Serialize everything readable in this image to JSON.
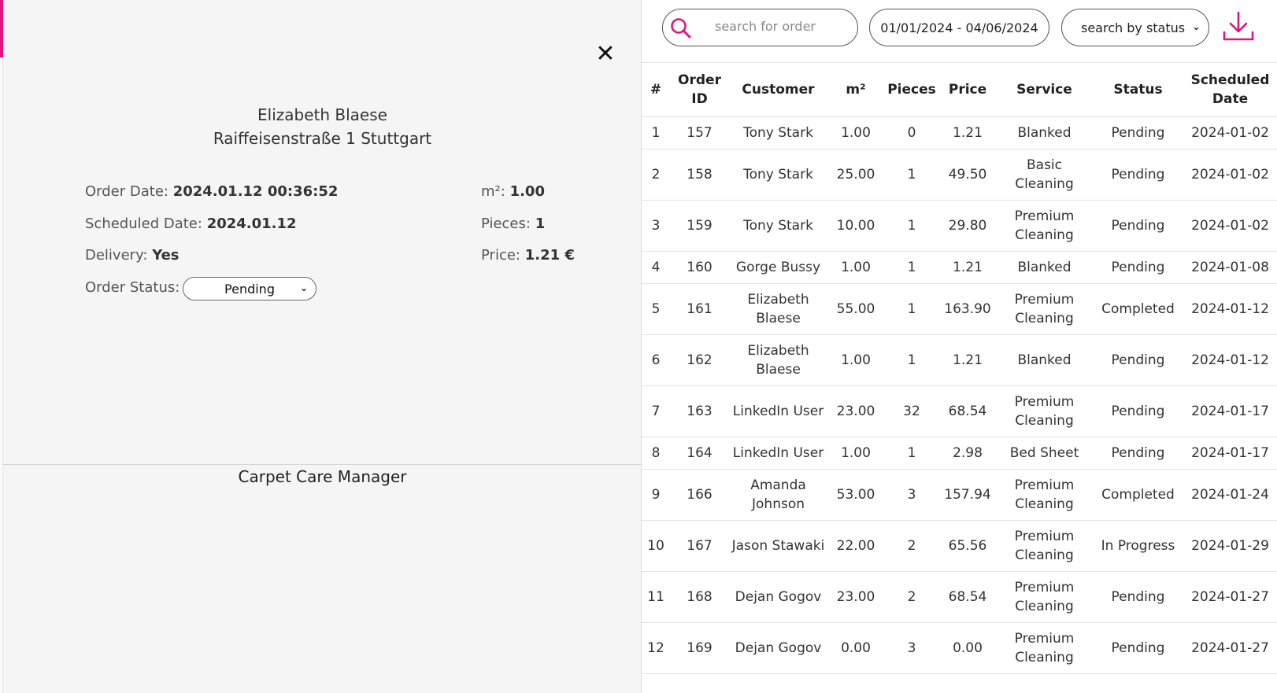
{
  "detail": {
    "close_symbol": "✕",
    "customer_name": "Elizabeth Blaese",
    "address": "Raiffeisenstraße 1 Stuttgart",
    "order_date_label": "Order Date:",
    "order_date_value": "2024.01.12 00:36:52",
    "scheduled_date_label": "Scheduled Date:",
    "scheduled_date_value": "2024.01.12",
    "delivery_label": "Delivery:",
    "delivery_value": "Yes",
    "order_status_label": "Order Status:",
    "order_status_value": "Pending",
    "area_label": "m²:",
    "area_value": "1.00",
    "pieces_label": "Pieces:",
    "pieces_value": "1",
    "price_label": "Price:",
    "price_value": "1.21 €"
  },
  "app": {
    "title": "Carpet Care Manager"
  },
  "toolbar": {
    "search_placeholder": "search for order",
    "date_range": "01/01/2024 - 04/06/2024",
    "status_filter": "search by status"
  },
  "colors": {
    "accent": "#e0147a"
  },
  "icons": {
    "search": "search-icon",
    "download": "download-icon",
    "close": "close-icon",
    "chevron": "chevron-down-icon"
  },
  "table": {
    "headers": [
      "#",
      "Order ID",
      "Customer",
      "m²",
      "Pieces",
      "Price",
      "Service",
      "Status",
      "Scheduled Date"
    ],
    "rows": [
      [
        "1",
        "157",
        "Tony Stark",
        "1.00",
        "0",
        "1.21",
        "Blanked",
        "Pending",
        "2024-01-02"
      ],
      [
        "2",
        "158",
        "Tony Stark",
        "25.00",
        "1",
        "49.50",
        "Basic Cleaning",
        "Pending",
        "2024-01-02"
      ],
      [
        "3",
        "159",
        "Tony Stark",
        "10.00",
        "1",
        "29.80",
        "Premium Cleaning",
        "Pending",
        "2024-01-02"
      ],
      [
        "4",
        "160",
        "Gorge Bussy",
        "1.00",
        "1",
        "1.21",
        "Blanked",
        "Pending",
        "2024-01-08"
      ],
      [
        "5",
        "161",
        "Elizabeth Blaese",
        "55.00",
        "1",
        "163.90",
        "Premium Cleaning",
        "Completed",
        "2024-01-12"
      ],
      [
        "6",
        "162",
        "Elizabeth Blaese",
        "1.00",
        "1",
        "1.21",
        "Blanked",
        "Pending",
        "2024-01-12"
      ],
      [
        "7",
        "163",
        "LinkedIn User",
        "23.00",
        "32",
        "68.54",
        "Premium Cleaning",
        "Pending",
        "2024-01-17"
      ],
      [
        "8",
        "164",
        "LinkedIn User",
        "1.00",
        "1",
        "2.98",
        "Bed Sheet",
        "Pending",
        "2024-01-17"
      ],
      [
        "9",
        "166",
        "Amanda Johnson",
        "53.00",
        "3",
        "157.94",
        "Premium Cleaning",
        "Completed",
        "2024-01-24"
      ],
      [
        "10",
        "167",
        "Jason Stawaki",
        "22.00",
        "2",
        "65.56",
        "Premium Cleaning",
        "In Progress",
        "2024-01-29"
      ],
      [
        "11",
        "168",
        "Dejan Gogov",
        "23.00",
        "2",
        "68.54",
        "Premium Cleaning",
        "Pending",
        "2024-01-27"
      ],
      [
        "12",
        "169",
        "Dejan Gogov",
        "0.00",
        "3",
        "0.00",
        "Premium Cleaning",
        "Pending",
        "2024-01-27"
      ]
    ]
  }
}
